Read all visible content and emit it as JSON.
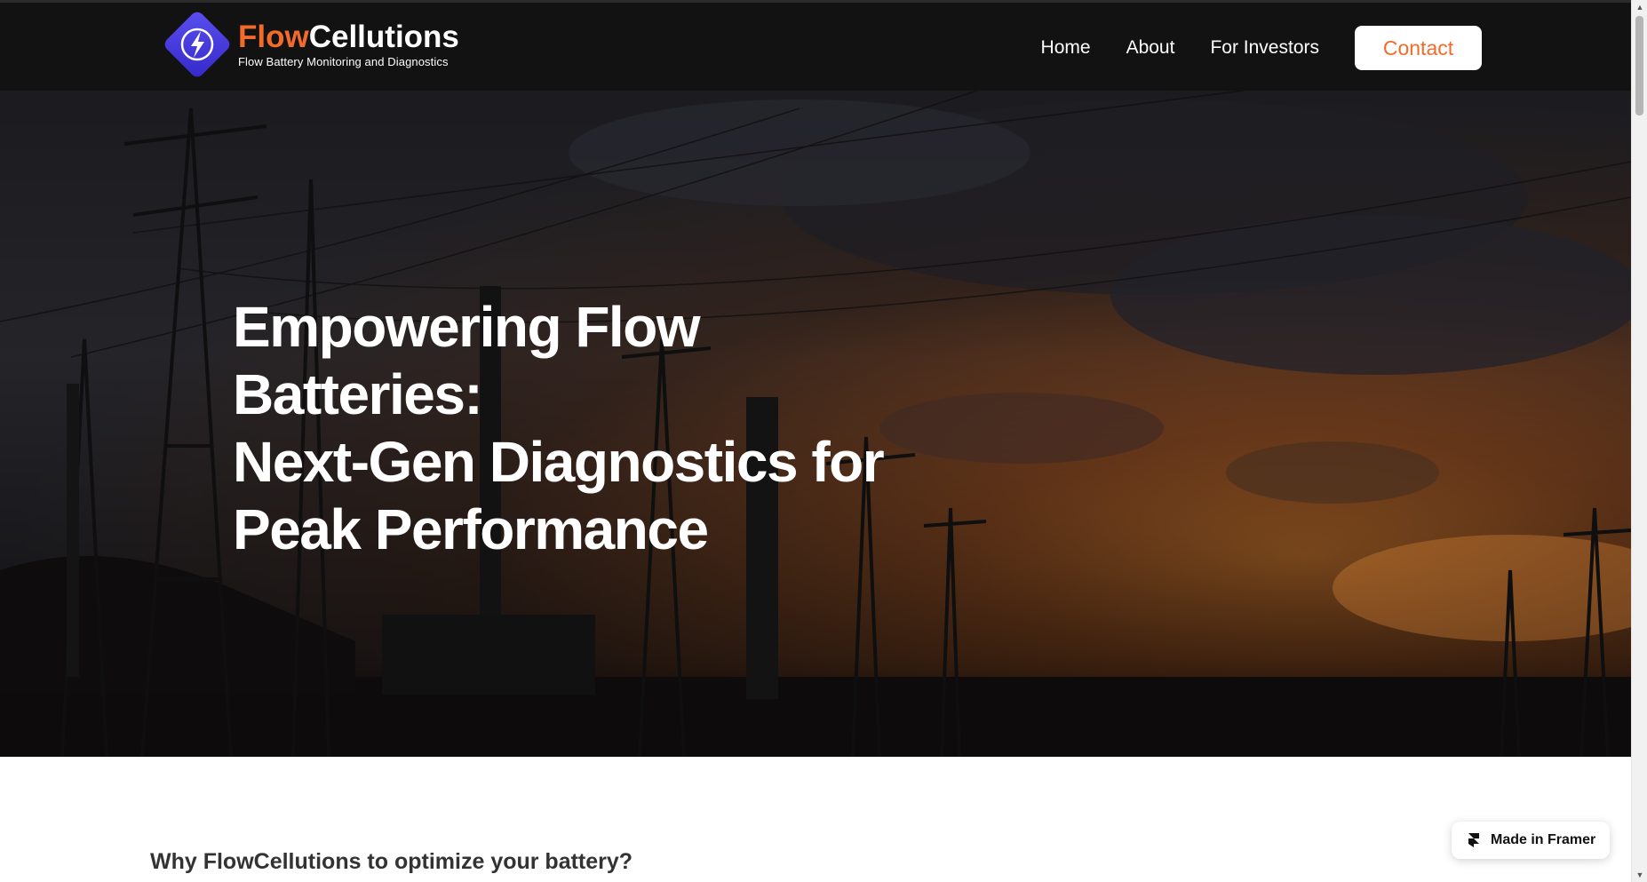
{
  "brand": {
    "name_part1": "Flow",
    "name_part2": "Cellutions",
    "tagline": "Flow Battery Monitoring and Diagnostics",
    "accent_color": "#f26b2a",
    "logo_color": "#4a3fe0"
  },
  "nav": {
    "links": [
      "Home",
      "About",
      "For Investors"
    ],
    "contact_label": "Contact"
  },
  "hero": {
    "title_lines": [
      "Empowering Flow",
      "Batteries:",
      "Next-Gen Diagnostics for",
      "Peak Performance"
    ]
  },
  "section": {
    "heading": "Why FlowCellutions to optimize your battery?"
  },
  "badge": {
    "label": "Made in Framer",
    "icon": "framer-icon"
  }
}
